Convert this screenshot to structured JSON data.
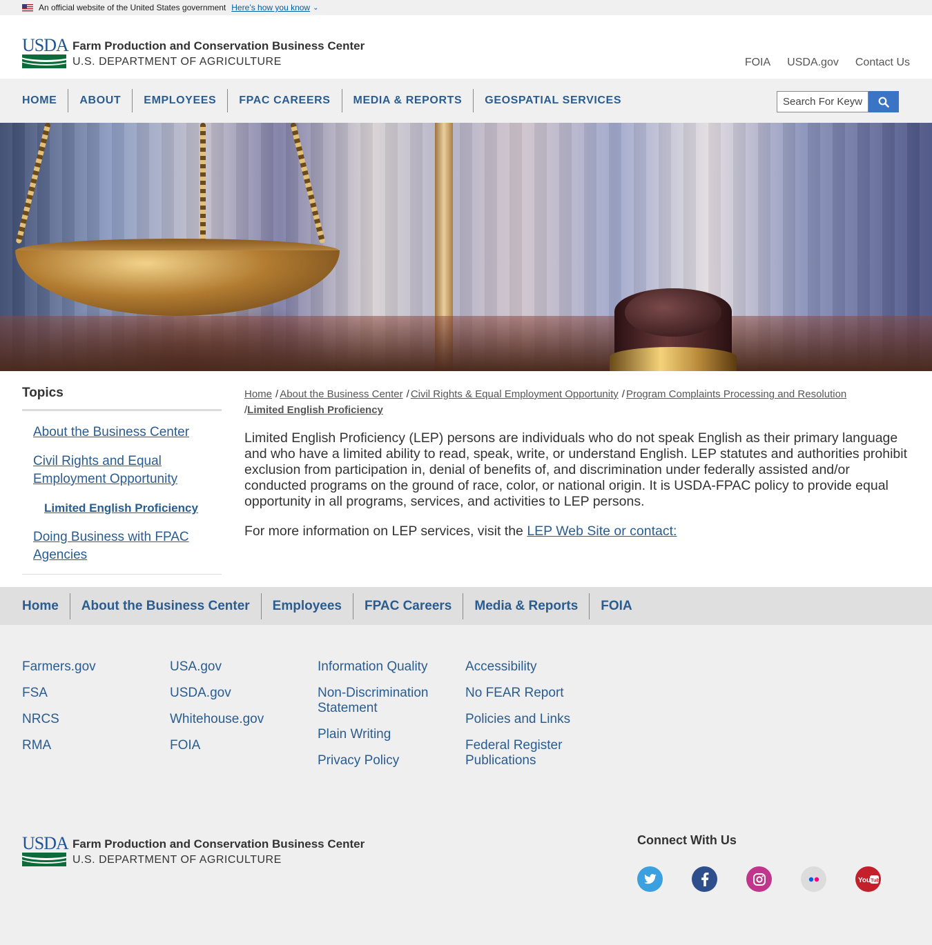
{
  "gov_banner": {
    "text": "An official website of the United States government",
    "link": "Here’s how you know"
  },
  "header": {
    "agency_name": "Farm Production and Conservation Business Center",
    "department": "U.S. DEPARTMENT OF AGRICULTURE",
    "logo_text": "USDA",
    "utility_links": [
      "FOIA",
      "USDA.gov",
      "Contact Us"
    ]
  },
  "nav": {
    "items": [
      "HOME",
      "ABOUT",
      "EMPLOYEES",
      "FPAC CAREERS",
      "MEDIA & REPORTS",
      "GEOSPATIAL SERVICES"
    ]
  },
  "search": {
    "value": "Search For Keyw"
  },
  "sidebar": {
    "title": "Topics",
    "items": [
      "About the Business Center",
      "Civil Rights and Equal Employment Opportunity",
      "Limited English Proficiency",
      "Doing Business with FPAC Agencies"
    ]
  },
  "breadcrumb": {
    "items": [
      "Home",
      "About the Business Center",
      "Civil Rights & Equal Employment Opportunity",
      "Program Complaints Processing and Resolution",
      "Limited English Proficiency"
    ],
    "separator": "/"
  },
  "main": {
    "paragraph1": "Limited English Proficiency (LEP) persons are individuals who do not speak English as their primary language and who have a limited ability to read, speak, write, or understand English. LEP statutes and authorities prohibit exclusion from participation in, denial of benefits of, and discrimination under federally assisted and/or conducted programs on the ground of race, color, or national origin. It is USDA-FPAC policy to provide equal opportunity in all programs, services, and activities to LEP persons.",
    "paragraph2_text": "For more information on LEP services, visit the ",
    "paragraph2_link": "LEP Web Site or contact:"
  },
  "footer_nav": {
    "items": [
      "Home",
      "About the Business Center",
      "Employees",
      "FPAC Careers",
      "Media & Reports",
      "FOIA"
    ]
  },
  "footer": {
    "columns": [
      [
        "Farmers.gov",
        "FSA",
        "NRCS",
        "RMA"
      ],
      [
        "USA.gov",
        "USDA.gov",
        "Whitehouse.gov",
        "FOIA"
      ],
      [
        "Information Quality",
        "Non-Discrimination Statement",
        "Plain Writing",
        "Privacy Policy"
      ],
      [
        "Accessibility",
        "No FEAR Report",
        "Policies and Links",
        "Federal Register Publications"
      ]
    ],
    "agency_name": "Farm Production and Conservation Business Center",
    "department": "U.S. DEPARTMENT OF AGRICULTURE",
    "connect_title": "Connect With Us",
    "socials": [
      {
        "icon": "twitter-icon",
        "color": "#1da1f2"
      },
      {
        "icon": "facebook-icon",
        "color": "#3b5998"
      },
      {
        "icon": "instagram-icon",
        "color": "#c13584"
      },
      {
        "icon": "flickr-icon",
        "color": "#dddddd"
      },
      {
        "icon": "youtube-icon",
        "color": "#cc181e"
      }
    ]
  },
  "colors": {
    "link": "#2a5c8f",
    "nav_bg": "#f0f0f0",
    "search_button": "#3b73c5",
    "usda_blue": "#205493",
    "usda_green": "#0d6b3a"
  }
}
